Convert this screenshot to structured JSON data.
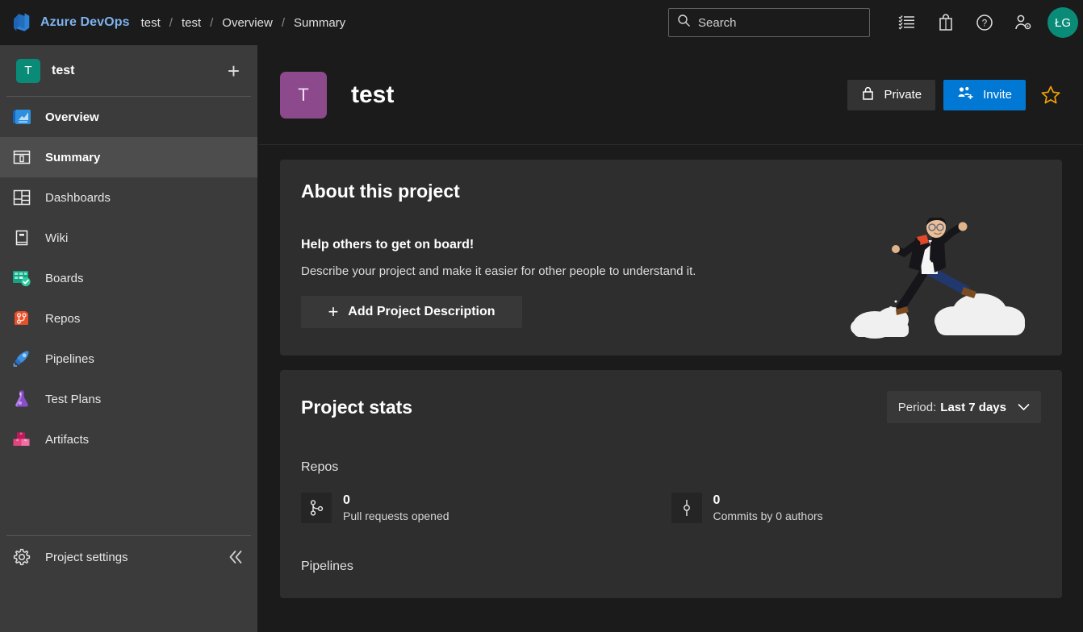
{
  "topbar": {
    "logo_icon": "azure-devops-logo-icon",
    "brand": "Azure DevOps",
    "breadcrumb": [
      {
        "label": "test"
      },
      {
        "label": "test"
      },
      {
        "label": "Overview"
      },
      {
        "label": "Summary"
      }
    ],
    "separator": "/",
    "search": {
      "icon": "search-icon",
      "placeholder": "Search",
      "value": ""
    },
    "icons": [
      {
        "name": "work-items-icon",
        "title": "View work items"
      },
      {
        "name": "marketplace-bag-icon",
        "title": "Marketplace"
      },
      {
        "name": "help-icon",
        "title": "Help"
      },
      {
        "name": "user-settings-icon",
        "title": "User settings"
      }
    ],
    "avatar": {
      "initials": "ŁG",
      "color": "#0a8b78"
    }
  },
  "sidebar": {
    "project": {
      "initial": "T",
      "name": "test",
      "avatar_color": "#0a8b78",
      "new_icon": "plus-icon"
    },
    "items": [
      {
        "label": "Overview",
        "icon": "overview-icon",
        "selected": false,
        "bold": true
      },
      {
        "label": "Summary",
        "icon": "summary-icon",
        "selected": true,
        "bold": true
      },
      {
        "label": "Dashboards",
        "icon": "dashboards-icon",
        "selected": false,
        "bold": false
      },
      {
        "label": "Wiki",
        "icon": "wiki-icon",
        "selected": false,
        "bold": false
      },
      {
        "label": "Boards",
        "icon": "boards-icon",
        "selected": false,
        "bold": false
      },
      {
        "label": "Repos",
        "icon": "repos-icon",
        "selected": false,
        "bold": false
      },
      {
        "label": "Pipelines",
        "icon": "pipelines-icon",
        "selected": false,
        "bold": false
      },
      {
        "label": "Test Plans",
        "icon": "test-plans-icon",
        "selected": false,
        "bold": false
      },
      {
        "label": "Artifacts",
        "icon": "artifacts-icon",
        "selected": false,
        "bold": false
      }
    ],
    "footer": {
      "label": "Project settings",
      "icon": "gear-icon",
      "collapse_icon": "chevron-double-left-icon"
    }
  },
  "project_header": {
    "avatar_initial": "T",
    "avatar_color": "#8c4a8c",
    "title": "test",
    "visibility_label": "Private",
    "visibility_icon": "lock-icon",
    "invite_label": "Invite",
    "invite_icon": "add-people-icon",
    "invite_color": "#0078d4",
    "favorite_icon": "star-outline-icon",
    "favorite_color": "#f2a100"
  },
  "about_card": {
    "title": "About this project",
    "subtitle": "Help others to get on board!",
    "description": "Describe your project and make it easier for other people to understand it.",
    "button_label": "Add Project Description",
    "button_icon": "plus-icon",
    "illustration": "person-jumping-on-clouds-illustration"
  },
  "stats_card": {
    "title": "Project stats",
    "period": {
      "prefix": "Period:",
      "value": "Last 7 days",
      "caret_icon": "chevron-down-icon"
    },
    "sections": [
      {
        "title": "Repos",
        "stats": [
          {
            "value": "0",
            "label": "Pull requests opened",
            "icon": "pull-request-icon"
          },
          {
            "value": "0",
            "label": "Commits by 0 authors",
            "icon": "commit-icon"
          }
        ]
      },
      {
        "title": "Pipelines",
        "stats": []
      }
    ]
  }
}
